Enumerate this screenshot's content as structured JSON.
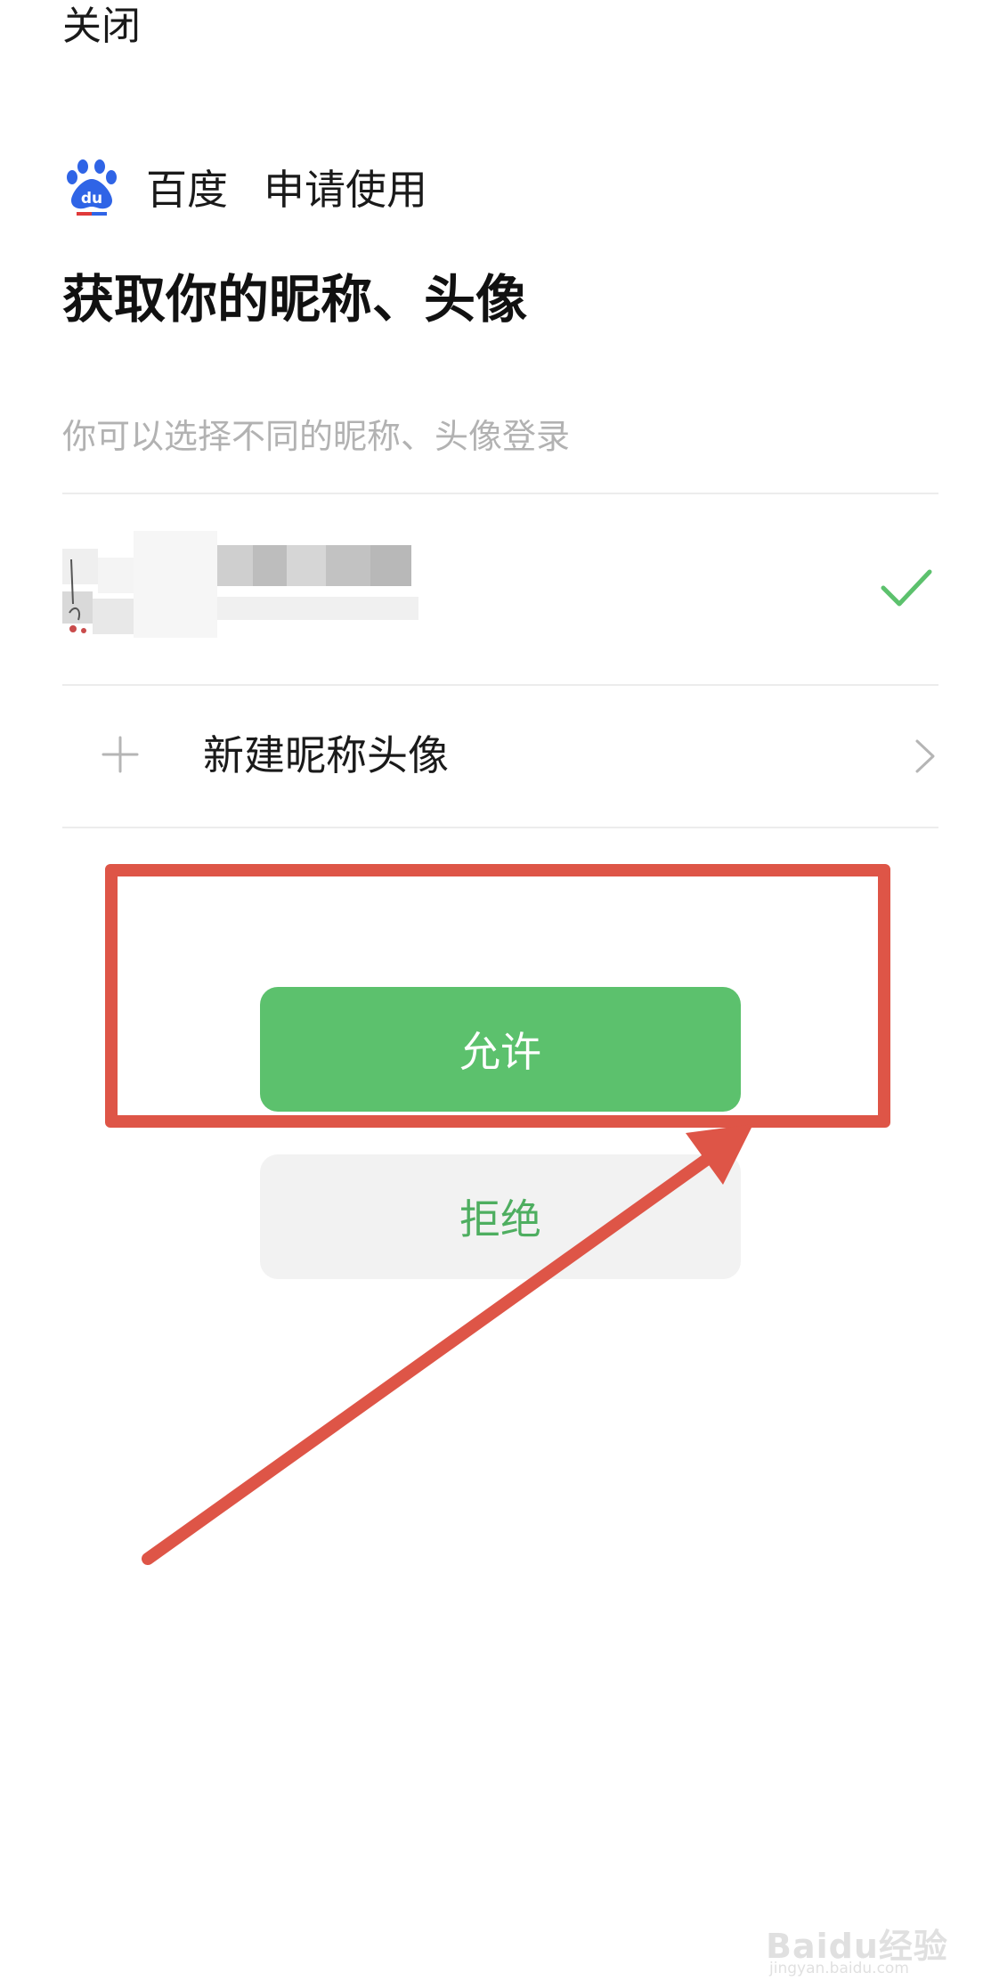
{
  "header": {
    "close_label": "关闭"
  },
  "app": {
    "name": "百度",
    "request_text": "申请使用",
    "logo_icon": "baidu-paw-logo-icon",
    "logo_text": "du"
  },
  "permission": {
    "title": "获取你的昵称、头像",
    "hint": "你可以选择不同的昵称、头像登录"
  },
  "profile_option": {
    "selected": true,
    "check_icon": "checkmark-icon"
  },
  "new_profile": {
    "label": "新建昵称头像",
    "plus_icon": "plus-icon",
    "chevron_icon": "chevron-right-icon"
  },
  "actions": {
    "allow_label": "允许",
    "deny_label": "拒绝"
  },
  "colors": {
    "primary_green": "#5cc16d",
    "deny_text_green": "#4eae60",
    "annotation_red": "#de5547",
    "hint_gray": "#b2b2b2"
  },
  "watermark": {
    "main": "Baidu经验",
    "sub": "jingyan.baidu.com"
  }
}
